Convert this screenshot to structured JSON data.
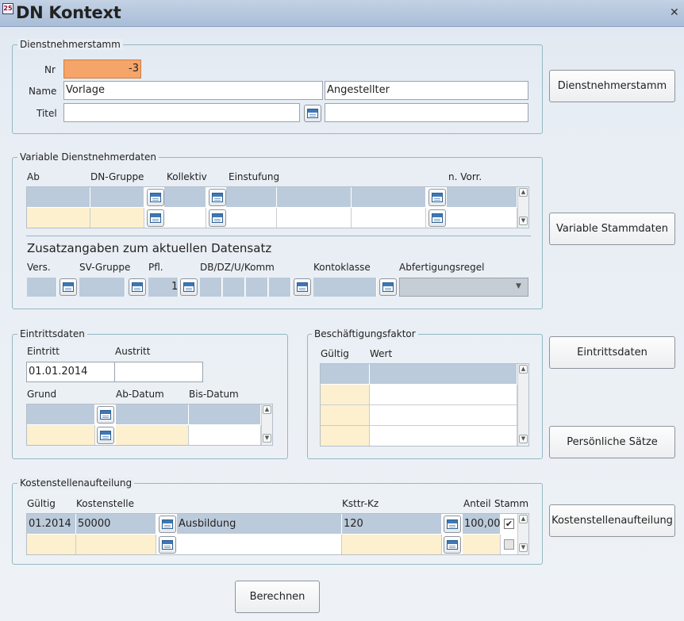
{
  "window": {
    "title": "DN Kontext",
    "app_icon": "25"
  },
  "dn_stamm": {
    "legend": "Dienstnehmerstamm",
    "nr_label": "Nr",
    "nr_value": "-3",
    "name_label": "Name",
    "name_first": "Vorlage",
    "name_second": "Angestellter",
    "titel_label": "Titel",
    "titel_value": "",
    "titel_value2": ""
  },
  "variable": {
    "legend": "Variable Dienstnehmerdaten",
    "col_ab": "Ab",
    "col_dngruppe": "DN-Gruppe",
    "col_kollektiv": "Kollektiv",
    "col_einstufung": "Einstufung",
    "col_nvorr": "n. Vorr.",
    "zusatz_title": "Zusatzangaben zum aktuellen Datensatz",
    "col_vers": "Vers.",
    "col_svgruppe": "SV-Gruppe",
    "col_pfl": "Pfl.",
    "col_dbdz": "DB/DZ/U/Komm",
    "col_kontoklasse": "Kontoklasse",
    "col_abfertigung": "Abfertigungsregel",
    "pfl_value": "1"
  },
  "eintritt": {
    "legend": "Eintrittsdaten",
    "eintritt_label": "Eintritt",
    "austritt_label": "Austritt",
    "eintritt_value": "01.01.2014",
    "austritt_value": "",
    "grund_label": "Grund",
    "abdatum_label": "Ab-Datum",
    "bisdatum_label": "Bis-Datum"
  },
  "beschaeftigung": {
    "legend": "Beschäftigungsfaktor",
    "col_gueltig": "Gültig",
    "col_wert": "Wert"
  },
  "kosten": {
    "legend": "Kostenstellenaufteilung",
    "col_gueltig": "Gültig",
    "col_kostenstelle": "Kostenstelle",
    "col_ksttr": "Ksttr-Kz",
    "col_anteil": "Anteil",
    "col_stamm": "Stamm",
    "row1": {
      "gueltig": "01.2014",
      "kostenstelle": "50000",
      "bezeichnung": "Ausbildung",
      "ksttr": "120",
      "anteil": "100,00",
      "stamm_checked": "✔"
    }
  },
  "buttons": {
    "dienstnehmerstamm": "Dienstnehmerstamm",
    "variable_stammdaten": "Variable Stammdaten",
    "eintrittsdaten": "Eintrittsdaten",
    "persoenliche_saetze": "Persönliche Sätze",
    "kostenstellenaufteilung": "Kostenstellenaufteilung",
    "berechnen": "Berechnen"
  },
  "colors": {
    "nr_field": "#f5a46a",
    "grid_header": "#bccbdb",
    "grid_new_row": "#fdf0cf"
  }
}
